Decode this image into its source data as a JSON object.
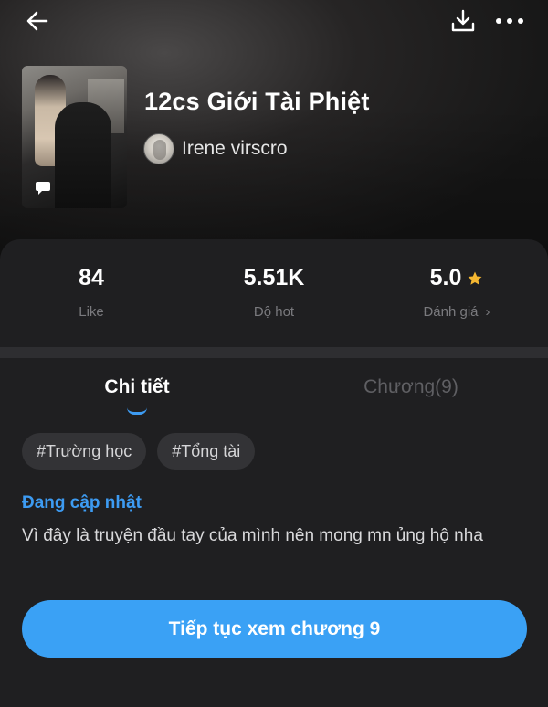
{
  "story": {
    "title": "12cs Giới Tài Phiệt",
    "author": "Irene virscro",
    "cover_badge_icon": "chat-bubble-icon"
  },
  "topbar": {
    "back_icon": "arrow-left-icon",
    "download_icon": "download-icon",
    "more_icon": "more-horizontal-icon"
  },
  "stats": [
    {
      "value": "84",
      "label": "Like"
    },
    {
      "value": "5.51K",
      "label": "Độ hot"
    },
    {
      "value": "5.0",
      "label": "Đánh giá",
      "chevron": "›"
    }
  ],
  "tabs": [
    {
      "label": "Chi tiết",
      "active": true
    },
    {
      "label": "Chương(9)",
      "active": false
    }
  ],
  "tags": [
    "#Trường học",
    "#Tổng tài"
  ],
  "status": "Đang cập nhật",
  "description": "Vì đây là truyện đầu tay của mình nên mong mn ủng hộ nha",
  "cta_label": "Tiếp tục xem chương 9",
  "colors": {
    "accent": "#3d9bf2",
    "star": "#f5b731",
    "background": "#1f1f21"
  }
}
